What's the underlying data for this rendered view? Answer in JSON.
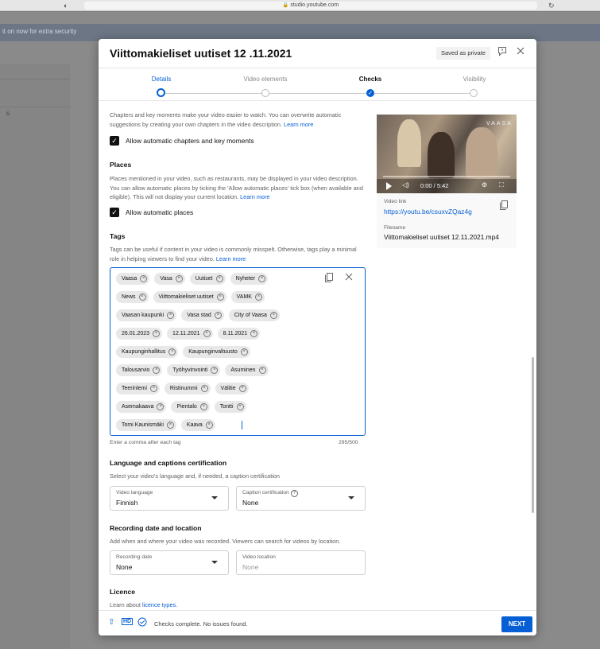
{
  "browser": {
    "url": "studio.youtube.com",
    "lock_glyph": "🔒"
  },
  "backdrop": {
    "banner_text": "it on now for extra security",
    "stray_char": "s"
  },
  "dialog": {
    "title": "Viittomakieliset uutiset 12 .11.2021",
    "saved_chip": "Saved as private",
    "steps": [
      {
        "label": "Details",
        "state": "current"
      },
      {
        "label": "Video elements",
        "state": "upcoming"
      },
      {
        "label": "Checks",
        "state": "done"
      },
      {
        "label": "Visibility",
        "state": "upcoming"
      }
    ]
  },
  "chapters": {
    "description": "Chapters and key moments make your video easier to watch. You can overwrite automatic suggestions by creating your own chapters in the video description.",
    "learn_more": "Learn more",
    "checkbox_label": "Allow automatic chapters and key moments"
  },
  "places": {
    "heading": "Places",
    "description": "Places mentioned in your video, such as restaurants, may be displayed in your video description. You can allow automatic places by ticking the 'Allow automatic places' tick box (when available and eligible). This will not display your current location.",
    "learn_more": "Learn more",
    "checkbox_label": "Allow automatic places"
  },
  "tags": {
    "heading": "Tags",
    "description": "Tags can be useful if content in your video is commonly misspelt. Otherwise, tags play a minimal role in helping viewers to find your video.",
    "learn_more": "Learn more",
    "rows": [
      [
        "Vaasa",
        "Vasa",
        "Uutiset",
        "Nyheter"
      ],
      [
        "News",
        "Viittomakieliset uutiset",
        "VAMK"
      ],
      [
        "Vaasan kaupunki",
        "Vasa stad",
        "City of Vaasa"
      ],
      [
        "26.01.2023",
        "12.11.2021",
        "8.11.2021"
      ],
      [
        "Kaupunginhallitus",
        "Kaupunginvaltuusto"
      ],
      [
        "Talousarvio",
        "Työhyvinvointi",
        "Asuminen"
      ],
      [
        "Teerinlemi",
        "Ristinummi",
        "Välitie"
      ],
      [
        "Asemakaava",
        "Pientalo",
        "Tontti"
      ],
      [
        "Tomi Kaunismäki",
        "Kaava"
      ]
    ],
    "hint": "Enter a comma after each tag",
    "counter": "295/500"
  },
  "language": {
    "heading": "Language and captions certification",
    "description": "Select your video's language and, if needed, a caption certification",
    "video_language_label": "Video language",
    "video_language_value": "Finnish",
    "caption_cert_label": "Caption certification",
    "caption_cert_value": "None"
  },
  "recording": {
    "heading": "Recording date and location",
    "description": "Add when and where your video was recorded. Viewers can search for videos by location.",
    "date_label": "Recording date",
    "date_value": "None",
    "location_label": "Video location",
    "location_placeholder": "None"
  },
  "licence": {
    "heading": "Licence",
    "learn_prefix": "Learn about",
    "learn_link": "licence types."
  },
  "preview": {
    "brand": "VAASA",
    "time": "0:00 / 5:42",
    "video_link_label": "Video link",
    "video_link": "https://youtu.be/csuxvZQaz4g",
    "filename_label": "Filename",
    "filename": "Viittomakieliset uutiset 12.11.2021.mp4"
  },
  "footer": {
    "status": "Checks complete. No issues found.",
    "next_label": "NEXT",
    "hd_badge": "HD"
  },
  "colors": {
    "accent": "#065fd4",
    "text": "#111111",
    "muted": "#606060"
  }
}
